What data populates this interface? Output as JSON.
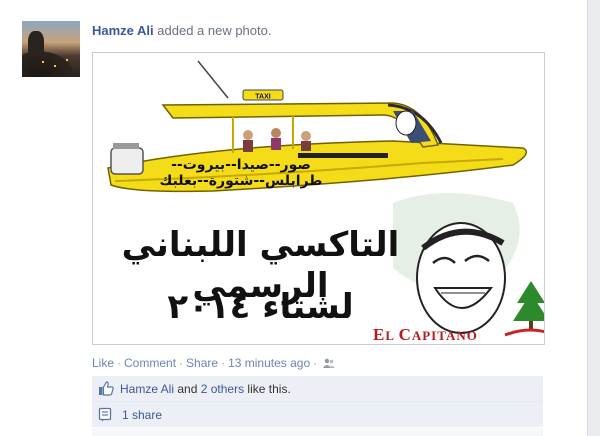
{
  "story": {
    "author": "Hamze Ali",
    "action_text": " added a new photo."
  },
  "photo": {
    "boat_cities": "صور--صيدا--بيروت--طرابلس--شتورة--بعلبك",
    "taxi_sign": "TAXI",
    "headline": "التاكسي اللبناني الرسمي",
    "subline": "لشتاء ٢٠١٤",
    "brand_first": "E",
    "brand_mid": "L ",
    "brand_cap": "C",
    "brand_rest": "APITANO"
  },
  "actions": {
    "like": "Like",
    "comment": "Comment",
    "share": "Share",
    "time": "13 minutes ago",
    "sep": "·"
  },
  "likes": {
    "name": "Hamze Ali",
    "and": " and ",
    "others": "2 others",
    "suffix": " like this."
  },
  "shares": {
    "text": "1 share"
  },
  "colors": {
    "link": "#3b5998",
    "boat_yellow": "#f5dc18",
    "brand_red": "#b41c1c"
  },
  "icons": {
    "privacy": "people-icon",
    "like": "thumbs-up-icon",
    "share": "share-icon"
  }
}
